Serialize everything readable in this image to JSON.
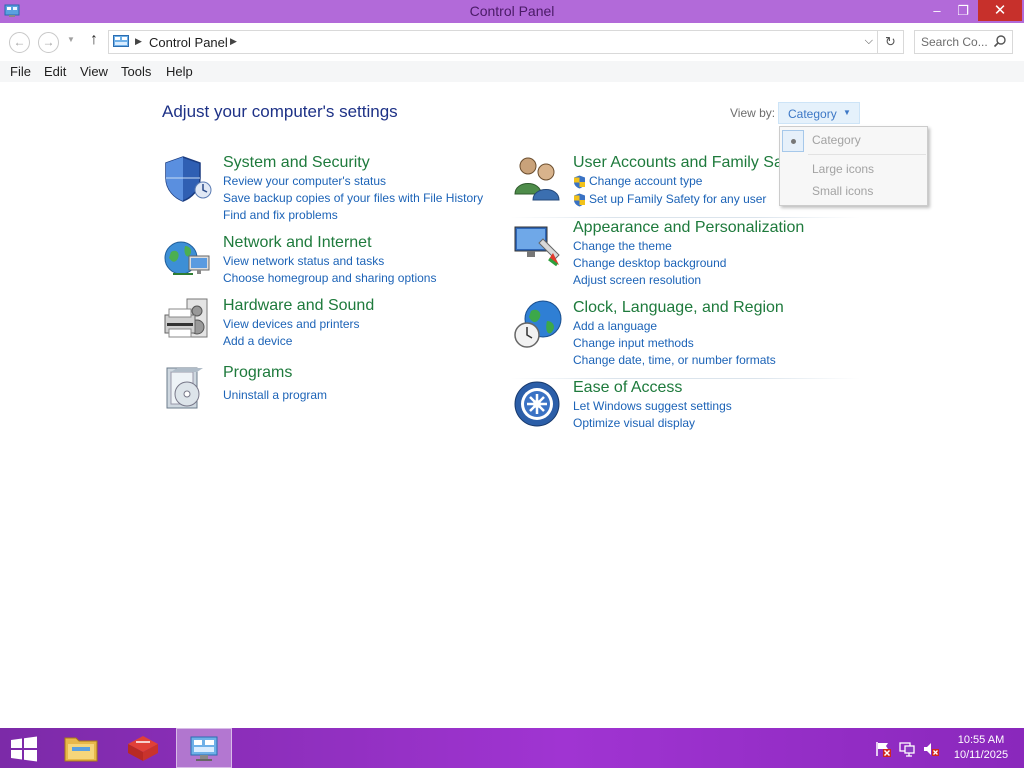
{
  "window": {
    "title": "Control Panel",
    "icon": "control-panel-icon",
    "controls": {
      "minimize": "–",
      "maximize": "❐",
      "close": "✕"
    }
  },
  "address": {
    "back_icon": "back-arrow-icon",
    "forward_icon": "forward-arrow-icon",
    "up_icon": "up-arrow-icon",
    "breadcrumb": [
      "Control Panel"
    ],
    "search_placeholder": "Search Co..."
  },
  "menu": {
    "items": [
      "File",
      "Edit",
      "View",
      "Tools",
      "Help"
    ]
  },
  "main": {
    "heading": "Adjust your computer's settings",
    "view_by": {
      "label": "View by:",
      "selected": "Category",
      "options": [
        "Category",
        "Large icons",
        "Small icons"
      ]
    },
    "categories": [
      {
        "title": "System and Security",
        "icon": "shield-icon",
        "links": [
          "Review your computer's status",
          "Save backup copies of your files with File History",
          "Find and fix problems"
        ]
      },
      {
        "title": "Network and Internet",
        "icon": "network-globe-icon",
        "links": [
          "View network status and tasks",
          "Choose homegroup and sharing options"
        ]
      },
      {
        "title": "Hardware and Sound",
        "icon": "printer-speaker-icon",
        "links": [
          "View devices and printers",
          "Add a device"
        ]
      },
      {
        "title": "Programs",
        "icon": "programs-disc-icon",
        "links": [
          "Uninstall a program"
        ]
      },
      {
        "title": "User Accounts and Family Safety",
        "icon": "users-icon",
        "links": [
          "Change account type",
          "Set up Family Safety for any user"
        ]
      },
      {
        "title": "Appearance and Personalization",
        "icon": "monitor-paint-icon",
        "links": [
          "Change the theme",
          "Change desktop background",
          "Adjust screen resolution"
        ]
      },
      {
        "title": "Clock, Language, and Region",
        "icon": "clock-globe-icon",
        "links": [
          "Add a language",
          "Change input methods",
          "Change date, time, or number formats"
        ]
      },
      {
        "title": "Ease of Access",
        "icon": "ease-of-access-icon",
        "links": [
          "Let Windows suggest settings",
          "Optimize visual display"
        ]
      }
    ]
  },
  "taskbar": {
    "items": [
      "start-icon",
      "file-explorer-icon",
      "app-cube-icon",
      "control-panel-icon"
    ],
    "tray": [
      "action-center-flag-icon",
      "network-icon",
      "volume-muted-icon"
    ],
    "time": "10:55 AM",
    "date": "10/11/2025"
  }
}
